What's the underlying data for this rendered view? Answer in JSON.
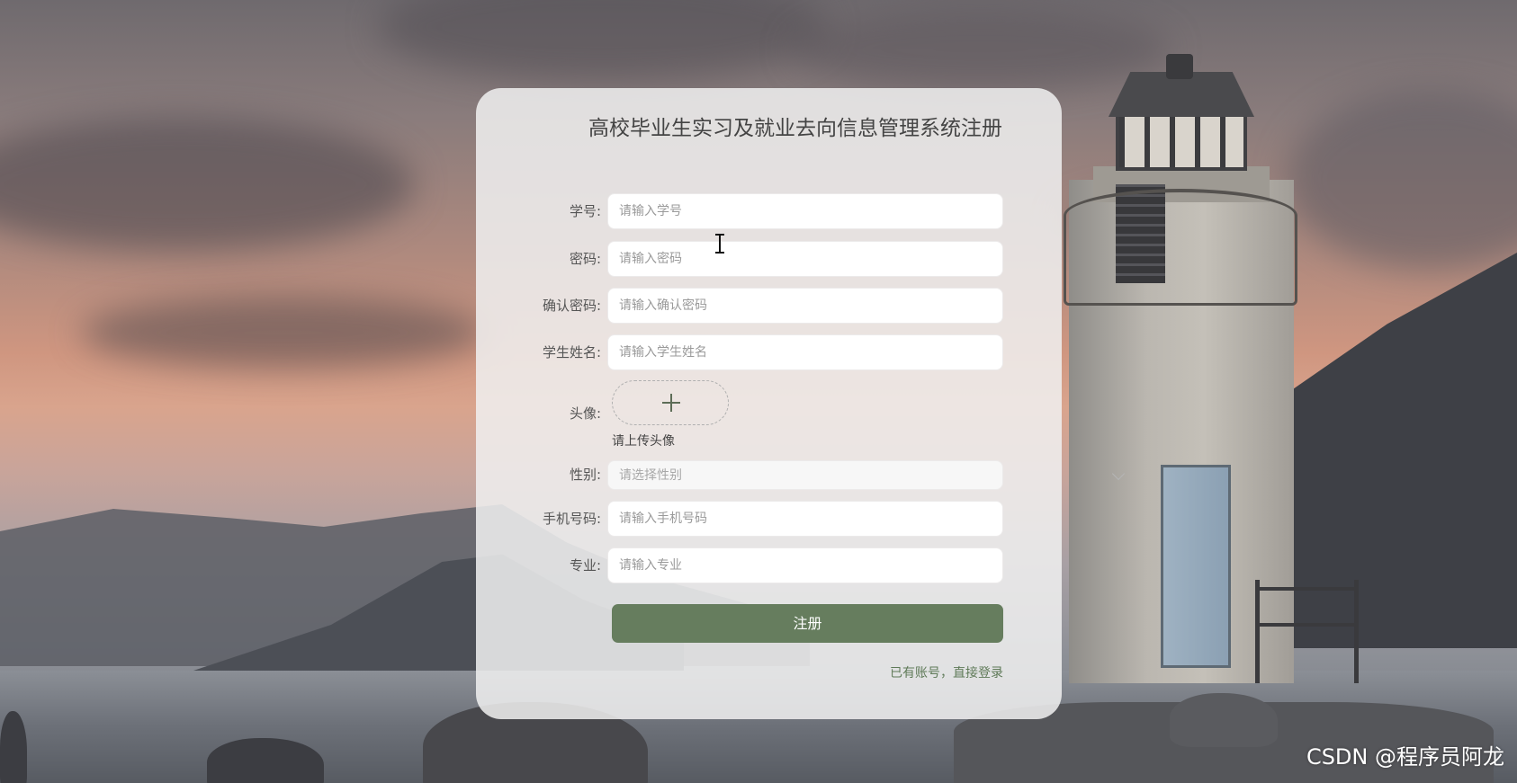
{
  "register": {
    "title": "高校毕业生实习及就业去向信息管理系统注册",
    "fields": [
      {
        "label": "学号:",
        "placeholder": "请输入学号"
      },
      {
        "label": "密码:",
        "placeholder": "请输入密码"
      },
      {
        "label": "确认密码:",
        "placeholder": "请输入确认密码"
      },
      {
        "label": "学生姓名:",
        "placeholder": "请输入学生姓名"
      }
    ],
    "avatar": {
      "label": "头像:",
      "hint": "请上传头像"
    },
    "gender": {
      "label": "性别:",
      "placeholder": "请选择性别"
    },
    "phone": {
      "label": "手机号码:",
      "placeholder": "请输入手机号码"
    },
    "major": {
      "label": "专业:",
      "placeholder": "请输入专业"
    },
    "submit_label": "注册",
    "login_link": "已有账号，直接登录"
  },
  "watermark": "CSDN @程序员阿龙",
  "colors": {
    "primary": "#667d5e",
    "link": "#5f7a58",
    "card": "#f0f0f0"
  }
}
